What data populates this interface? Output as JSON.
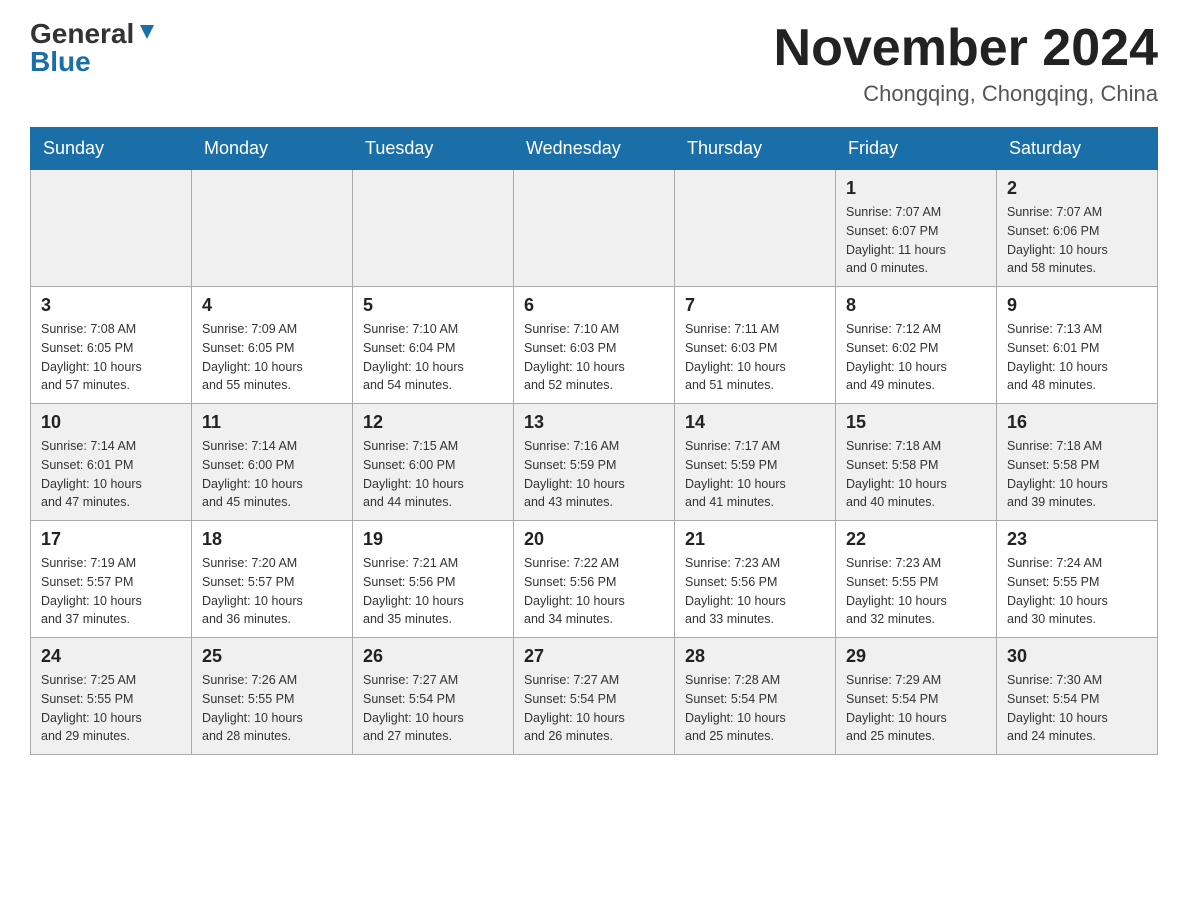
{
  "header": {
    "logo_general": "General",
    "logo_blue": "Blue",
    "month_title": "November 2024",
    "location": "Chongqing, Chongqing, China"
  },
  "weekdays": [
    "Sunday",
    "Monday",
    "Tuesday",
    "Wednesday",
    "Thursday",
    "Friday",
    "Saturday"
  ],
  "rows": [
    {
      "cells": [
        {
          "day": "",
          "info": ""
        },
        {
          "day": "",
          "info": ""
        },
        {
          "day": "",
          "info": ""
        },
        {
          "day": "",
          "info": ""
        },
        {
          "day": "",
          "info": ""
        },
        {
          "day": "1",
          "info": "Sunrise: 7:07 AM\nSunset: 6:07 PM\nDaylight: 11 hours\nand 0 minutes."
        },
        {
          "day": "2",
          "info": "Sunrise: 7:07 AM\nSunset: 6:06 PM\nDaylight: 10 hours\nand 58 minutes."
        }
      ]
    },
    {
      "cells": [
        {
          "day": "3",
          "info": "Sunrise: 7:08 AM\nSunset: 6:05 PM\nDaylight: 10 hours\nand 57 minutes."
        },
        {
          "day": "4",
          "info": "Sunrise: 7:09 AM\nSunset: 6:05 PM\nDaylight: 10 hours\nand 55 minutes."
        },
        {
          "day": "5",
          "info": "Sunrise: 7:10 AM\nSunset: 6:04 PM\nDaylight: 10 hours\nand 54 minutes."
        },
        {
          "day": "6",
          "info": "Sunrise: 7:10 AM\nSunset: 6:03 PM\nDaylight: 10 hours\nand 52 minutes."
        },
        {
          "day": "7",
          "info": "Sunrise: 7:11 AM\nSunset: 6:03 PM\nDaylight: 10 hours\nand 51 minutes."
        },
        {
          "day": "8",
          "info": "Sunrise: 7:12 AM\nSunset: 6:02 PM\nDaylight: 10 hours\nand 49 minutes."
        },
        {
          "day": "9",
          "info": "Sunrise: 7:13 AM\nSunset: 6:01 PM\nDaylight: 10 hours\nand 48 minutes."
        }
      ]
    },
    {
      "cells": [
        {
          "day": "10",
          "info": "Sunrise: 7:14 AM\nSunset: 6:01 PM\nDaylight: 10 hours\nand 47 minutes."
        },
        {
          "day": "11",
          "info": "Sunrise: 7:14 AM\nSunset: 6:00 PM\nDaylight: 10 hours\nand 45 minutes."
        },
        {
          "day": "12",
          "info": "Sunrise: 7:15 AM\nSunset: 6:00 PM\nDaylight: 10 hours\nand 44 minutes."
        },
        {
          "day": "13",
          "info": "Sunrise: 7:16 AM\nSunset: 5:59 PM\nDaylight: 10 hours\nand 43 minutes."
        },
        {
          "day": "14",
          "info": "Sunrise: 7:17 AM\nSunset: 5:59 PM\nDaylight: 10 hours\nand 41 minutes."
        },
        {
          "day": "15",
          "info": "Sunrise: 7:18 AM\nSunset: 5:58 PM\nDaylight: 10 hours\nand 40 minutes."
        },
        {
          "day": "16",
          "info": "Sunrise: 7:18 AM\nSunset: 5:58 PM\nDaylight: 10 hours\nand 39 minutes."
        }
      ]
    },
    {
      "cells": [
        {
          "day": "17",
          "info": "Sunrise: 7:19 AM\nSunset: 5:57 PM\nDaylight: 10 hours\nand 37 minutes."
        },
        {
          "day": "18",
          "info": "Sunrise: 7:20 AM\nSunset: 5:57 PM\nDaylight: 10 hours\nand 36 minutes."
        },
        {
          "day": "19",
          "info": "Sunrise: 7:21 AM\nSunset: 5:56 PM\nDaylight: 10 hours\nand 35 minutes."
        },
        {
          "day": "20",
          "info": "Sunrise: 7:22 AM\nSunset: 5:56 PM\nDaylight: 10 hours\nand 34 minutes."
        },
        {
          "day": "21",
          "info": "Sunrise: 7:23 AM\nSunset: 5:56 PM\nDaylight: 10 hours\nand 33 minutes."
        },
        {
          "day": "22",
          "info": "Sunrise: 7:23 AM\nSunset: 5:55 PM\nDaylight: 10 hours\nand 32 minutes."
        },
        {
          "day": "23",
          "info": "Sunrise: 7:24 AM\nSunset: 5:55 PM\nDaylight: 10 hours\nand 30 minutes."
        }
      ]
    },
    {
      "cells": [
        {
          "day": "24",
          "info": "Sunrise: 7:25 AM\nSunset: 5:55 PM\nDaylight: 10 hours\nand 29 minutes."
        },
        {
          "day": "25",
          "info": "Sunrise: 7:26 AM\nSunset: 5:55 PM\nDaylight: 10 hours\nand 28 minutes."
        },
        {
          "day": "26",
          "info": "Sunrise: 7:27 AM\nSunset: 5:54 PM\nDaylight: 10 hours\nand 27 minutes."
        },
        {
          "day": "27",
          "info": "Sunrise: 7:27 AM\nSunset: 5:54 PM\nDaylight: 10 hours\nand 26 minutes."
        },
        {
          "day": "28",
          "info": "Sunrise: 7:28 AM\nSunset: 5:54 PM\nDaylight: 10 hours\nand 25 minutes."
        },
        {
          "day": "29",
          "info": "Sunrise: 7:29 AM\nSunset: 5:54 PM\nDaylight: 10 hours\nand 25 minutes."
        },
        {
          "day": "30",
          "info": "Sunrise: 7:30 AM\nSunset: 5:54 PM\nDaylight: 10 hours\nand 24 minutes."
        }
      ]
    }
  ]
}
